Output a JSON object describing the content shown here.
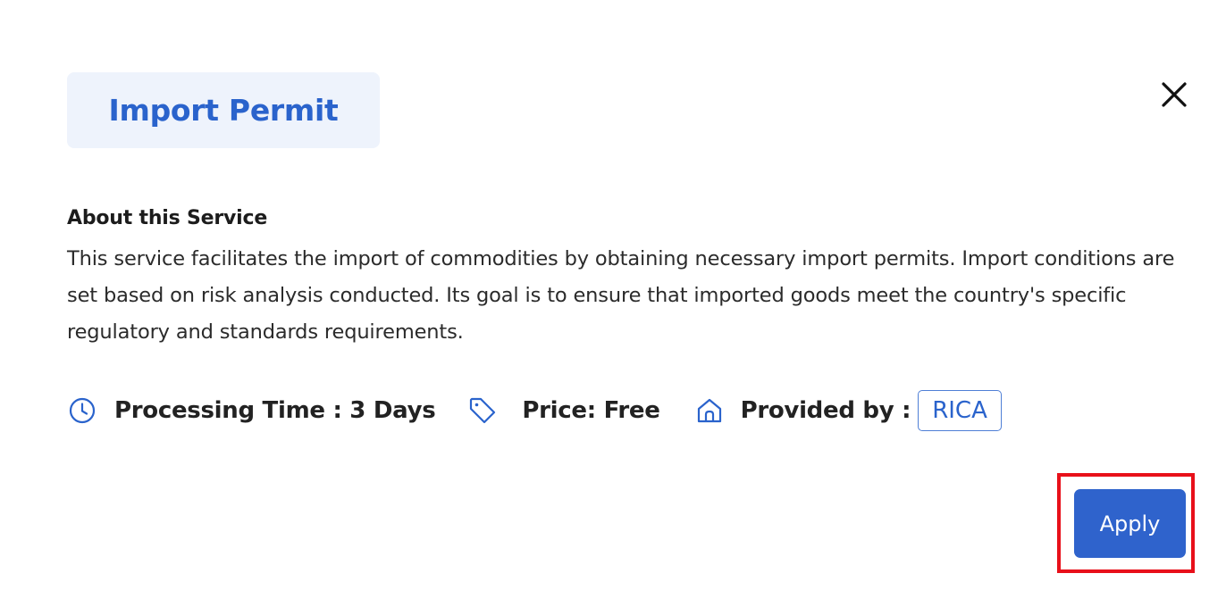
{
  "modal": {
    "title": "Import Permit",
    "close_icon": "close-icon"
  },
  "about": {
    "heading": "About this Service",
    "text": "This service facilitates the import of commodities by obtaining necessary import permits. Import conditions are set based on risk analysis conducted. Its goal is to ensure that imported goods meet the country's specific regulatory and standards requirements."
  },
  "meta": {
    "processing_time": "Processing Time : 3 Days",
    "price": "Price: Free",
    "provided_by_label": "Provided by :",
    "provider": "RICA",
    "icons": [
      "clock-icon",
      "price-tag-icon",
      "home-icon"
    ]
  },
  "actions": {
    "apply_label": "Apply"
  },
  "colors": {
    "accent": "#2f63cc",
    "chip_background": "#eef3fc",
    "highlight": "#e8101a"
  }
}
